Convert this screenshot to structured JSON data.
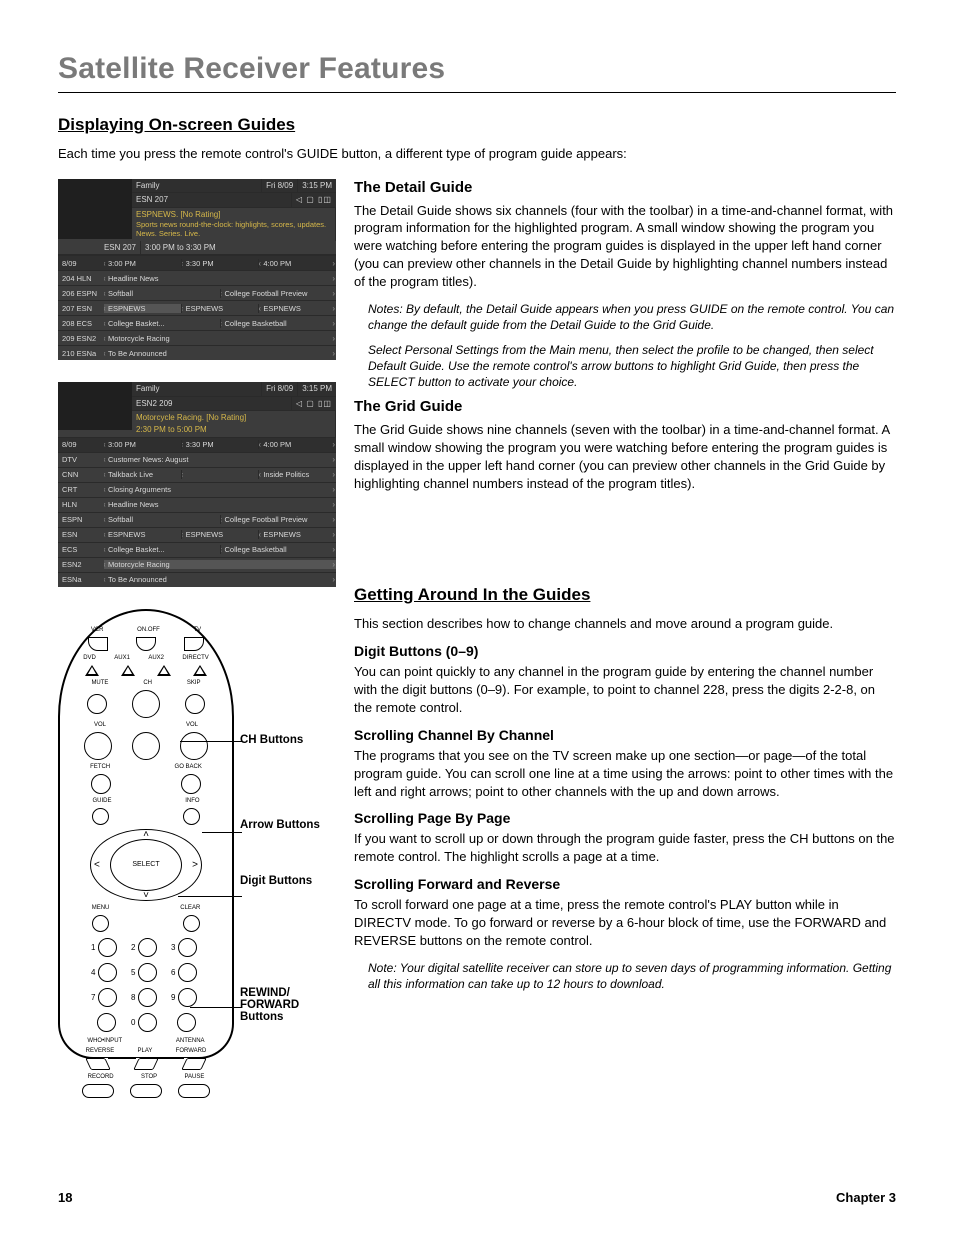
{
  "page": {
    "title": "Satellite Receiver Features",
    "footer_page": "18",
    "footer_chapter": "Chapter 3"
  },
  "sec1": {
    "heading": "Displaying On-screen Guides",
    "intro": "Each time you press the remote control's GUIDE button, a different type of program guide appears:"
  },
  "detail": {
    "heading": "The Detail Guide",
    "body": "The Detail Guide shows six channels (four with the toolbar) in a time-and-channel format, with program information for the highlighted program. A small window showing the program you were watching before entering the program guides is displayed in the upper left hand corner (you can preview other channels in the Detail Guide by highlighting channel numbers instead of the program titles).",
    "note1": "Notes: By default, the Detail Guide appears when you press GUIDE on the remote control. You can change the default guide from the Detail Guide to the Grid Guide.",
    "note2": "Select Personal Settings from the Main menu, then select the profile to be changed, then select Default Guide. Use the remote control's arrow buttons to highlight Grid Guide, then press the SELECT button to activate your choice."
  },
  "grid": {
    "heading": "The Grid Guide",
    "body": "The Grid Guide shows nine channels (seven with the toolbar) in a time-and-channel format. A small window showing the program you were watching before entering the program guides is displayed in the upper left hand corner (you can preview other channels in the Grid Guide by highlighting channel numbers instead of the program titles)."
  },
  "sec2": {
    "heading": "Getting Around In the Guides",
    "intro": "This section describes how to change channels and move around a program guide."
  },
  "digit": {
    "heading": "Digit Buttons (0–9)",
    "body": "You can point quickly to any channel in the program guide by entering the channel number with the digit buttons (0–9). For example, to point to channel 228, press the digits 2-2-8, on the remote control."
  },
  "scrollch": {
    "heading": "Scrolling Channel By Channel",
    "body": "The programs that you see on the TV screen make up one section—or page—of the total program guide. You can scroll one line at a time using the arrows: point to other times with the left and right arrows; point to other channels with the up and down arrows."
  },
  "scrollpg": {
    "heading": "Scrolling Page By Page",
    "body": "If you want to scroll up or down through the program guide faster, press the CH buttons on the remote control. The highlight scrolls a page at a time."
  },
  "scrollfr": {
    "heading": "Scrolling Forward and Reverse",
    "body": "To scroll forward one page at a time, press the remote control's PLAY button while in DIRECTV mode. To go forward or reverse by a 6-hour block of time, use the FORWARD and REVERSE buttons on the remote control.",
    "note": "Note: Your digital satellite receiver can store up to seven days of programming information. Getting all this information can take up to 12 hours to download."
  },
  "shot1": {
    "profile": "Family",
    "date": "Fri 8/09",
    "time": "3:15 PM",
    "ch_label": "ESN   207",
    "prog_name": "ESPNEWS. [No Rating]",
    "prog_desc": "Sports news round-the-clock: highlights, scores, updates. News. Series. Live.",
    "ch_line": "ESN 207",
    "time_line": "3:00 PM to 3:30 PM",
    "date_col": "8/09",
    "times": [
      "3:00 PM",
      "3:30 PM",
      "4:00 PM"
    ],
    "rows": [
      {
        "ch": "204 HLN",
        "cells": [
          "Headline News"
        ]
      },
      {
        "ch": "206 ESPN",
        "cells": [
          "Softball",
          "College Football Preview"
        ]
      },
      {
        "ch": "207 ESN",
        "cells": [
          "ESPNEWS",
          "ESPNEWS",
          "ESPNEWS"
        ]
      },
      {
        "ch": "208 ECS",
        "cells": [
          "College Basket...",
          "College Basketball"
        ]
      },
      {
        "ch": "209 ESN2",
        "cells": [
          "Motorcycle Racing"
        ]
      },
      {
        "ch": "210 ESNa",
        "cells": [
          "To Be Announced"
        ]
      }
    ]
  },
  "shot2": {
    "profile": "Family",
    "date": "Fri 8/09",
    "time": "3:15 PM",
    "ch_label": "ESN2   209",
    "prog_name": "Motorcycle Racing. [No Rating]",
    "time_line": "2:30 PM to 5:00 PM",
    "date_col": "8/09",
    "times": [
      "3:00 PM",
      "3:30 PM",
      "4:00 PM"
    ],
    "rows": [
      {
        "ch": "DTV",
        "cells": [
          "Customer News: August"
        ]
      },
      {
        "ch": "CNN",
        "cells": [
          "Talkback Live",
          "",
          "Inside Politics"
        ]
      },
      {
        "ch": "CRT",
        "cells": [
          "Closing Arguments"
        ]
      },
      {
        "ch": "HLN",
        "cells": [
          "Headline News"
        ]
      },
      {
        "ch": "ESPN",
        "cells": [
          "Softball",
          "College Football Preview"
        ]
      },
      {
        "ch": "ESN",
        "cells": [
          "ESPNEWS",
          "ESPNEWS",
          "ESPNEWS"
        ]
      },
      {
        "ch": "ECS",
        "cells": [
          "College Basket...",
          "College Basketball"
        ]
      },
      {
        "ch": "ESN2",
        "cells": [
          "Motorcycle Racing"
        ]
      },
      {
        "ch": "ESNa",
        "cells": [
          "To Be Announced"
        ]
      }
    ]
  },
  "remote": {
    "row1": [
      "VCR",
      "ON.OFF",
      "TV"
    ],
    "row2": [
      "DVD",
      "AUX1",
      "AUX2",
      "DIRECTV"
    ],
    "row3": [
      "MUTE",
      "",
      "SKIP"
    ],
    "ch_label": "CH",
    "vol_label": "VOL",
    "fetch": "FETCH",
    "goback": "GO BACK",
    "guide": "GUIDE",
    "info": "INFO",
    "select": "SELECT",
    "menu": "MENU",
    "clear": "CLEAR",
    "digits": [
      "1",
      "2",
      "3",
      "4",
      "5",
      "6",
      "7",
      "8",
      "9",
      "",
      "0",
      ""
    ],
    "who": "WHO•INPUT",
    "ant": "ANTENNA",
    "rev": "REVERSE",
    "play": "PLAY",
    "fwd": "FORWARD",
    "rec": "RECORD",
    "stop": "STOP",
    "pause": "PAUSE",
    "callouts": {
      "ch": "CH Buttons",
      "arrow": "Arrow Buttons",
      "digit": "Digit Buttons",
      "rf": "REWIND/ FORWARD Buttons"
    }
  }
}
